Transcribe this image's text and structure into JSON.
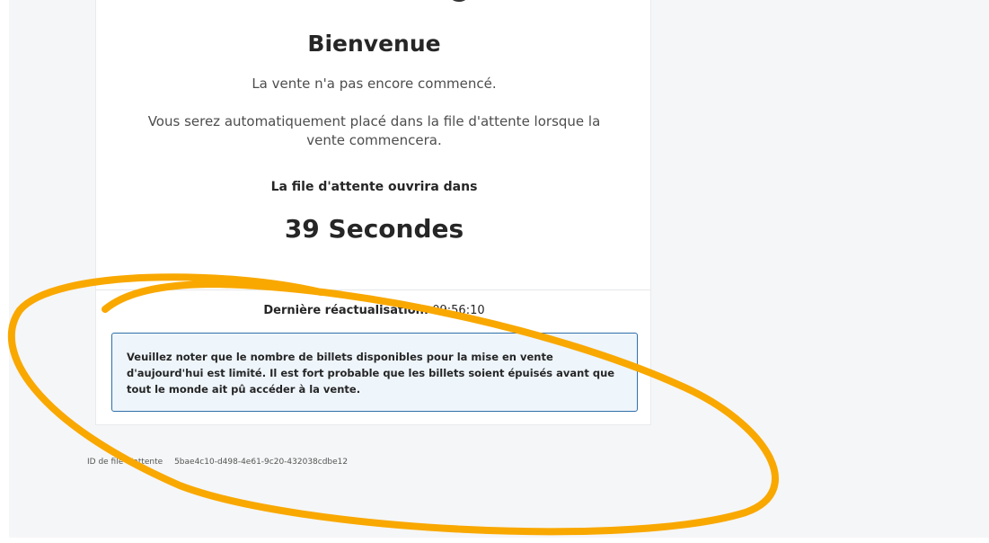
{
  "card": {
    "title": "Bienvenue",
    "subtitle": "La vente n'a pas encore commencé.",
    "info": "Vous serez automatiquement placé dans la file d'attente lorsque la vente commencera.",
    "queue_label": "La file d'attente ouvrira dans",
    "countdown": "39 Secondes",
    "refresh_label": "Dernière réactualisation:",
    "refresh_time": "09:56:10",
    "notice": "Veuillez noter que le nombre de billets disponibles pour la mise en vente d'aujourd'hui est limité. Il est fort probable que les billets soient épuisés avant que tout le monde ait pû accéder à la vente."
  },
  "footer": {
    "queue_id_label": "ID de file d'attente",
    "queue_id": "5bae4c10-d498-4e61-9c20-432038cdbe12"
  },
  "colors": {
    "annotation_stroke": "#f9a800",
    "notice_border": "#2f6fa8",
    "notice_background": "#eef5fb"
  }
}
